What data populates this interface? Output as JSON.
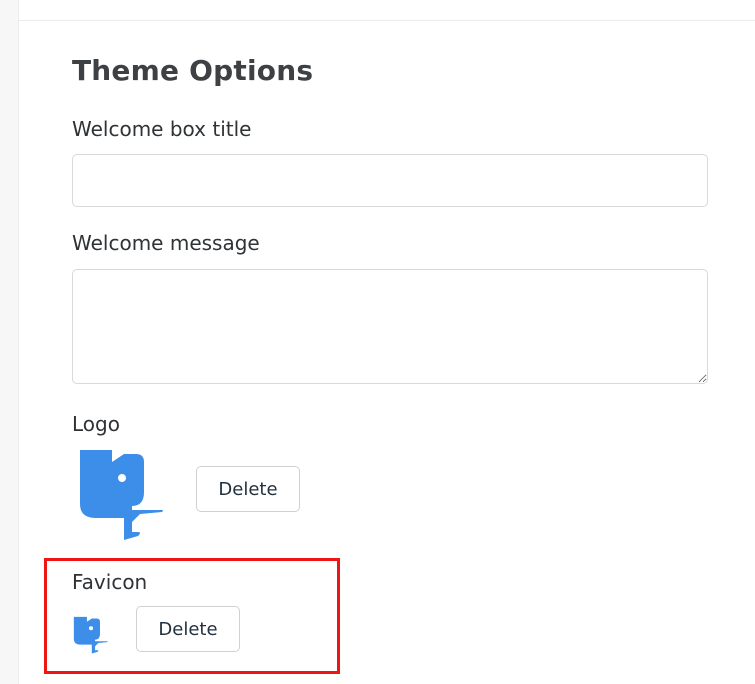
{
  "theme_options": {
    "title": "Theme Options",
    "welcome_box_title": {
      "label": "Welcome box title",
      "value": ""
    },
    "welcome_message": {
      "label": "Welcome message",
      "value": ""
    },
    "logo": {
      "label": "Logo",
      "delete_label": "Delete",
      "icon": "elephant-logo-icon"
    },
    "favicon": {
      "label": "Favicon",
      "delete_label": "Delete",
      "icon": "elephant-favicon-icon"
    }
  },
  "colors": {
    "logo_blue": "#3d8ee8",
    "highlight_red": "#ee1515",
    "heading": "#3e4144"
  }
}
